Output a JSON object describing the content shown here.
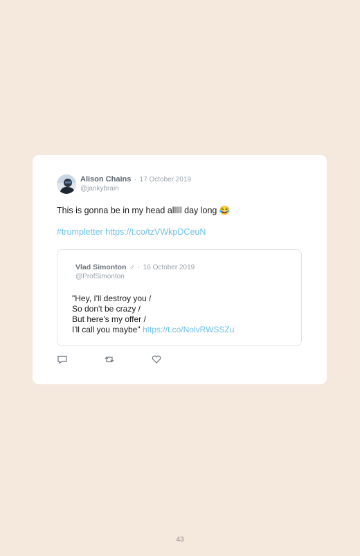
{
  "tweet": {
    "author_name": "Alison Chains",
    "separator": "·",
    "date": "17 October 2019",
    "handle": "@jankybrain",
    "text": "This is gonna be in my head alllll day long 😂",
    "hashtag": "#trumpletter",
    "link": "https://t.co/tzVWkpDCeuN"
  },
  "quoted_tweet": {
    "author_name": "Vlad Simonton",
    "gender_symbol": "♂",
    "separator": "·",
    "date": "16 October 2019",
    "handle": "@ProfSimonton",
    "lines": [
      "\"Hey, I'll destroy you /",
      "So don't be crazy /",
      "But here's my offer /",
      "I'll call you maybe\""
    ],
    "link": "https://t.co/NolvRWSSZu"
  },
  "actions": {
    "reply_icon": "reply-icon",
    "retweet_icon": "retweet-icon",
    "like_icon": "heart-icon"
  },
  "page": {
    "number": "43"
  },
  "colors": {
    "page_background": "#f5e8dd",
    "card_background": "#ffffff",
    "link": "#6fc0e8",
    "muted_text": "#9aa3ab",
    "body_text": "#1a1a1a"
  }
}
